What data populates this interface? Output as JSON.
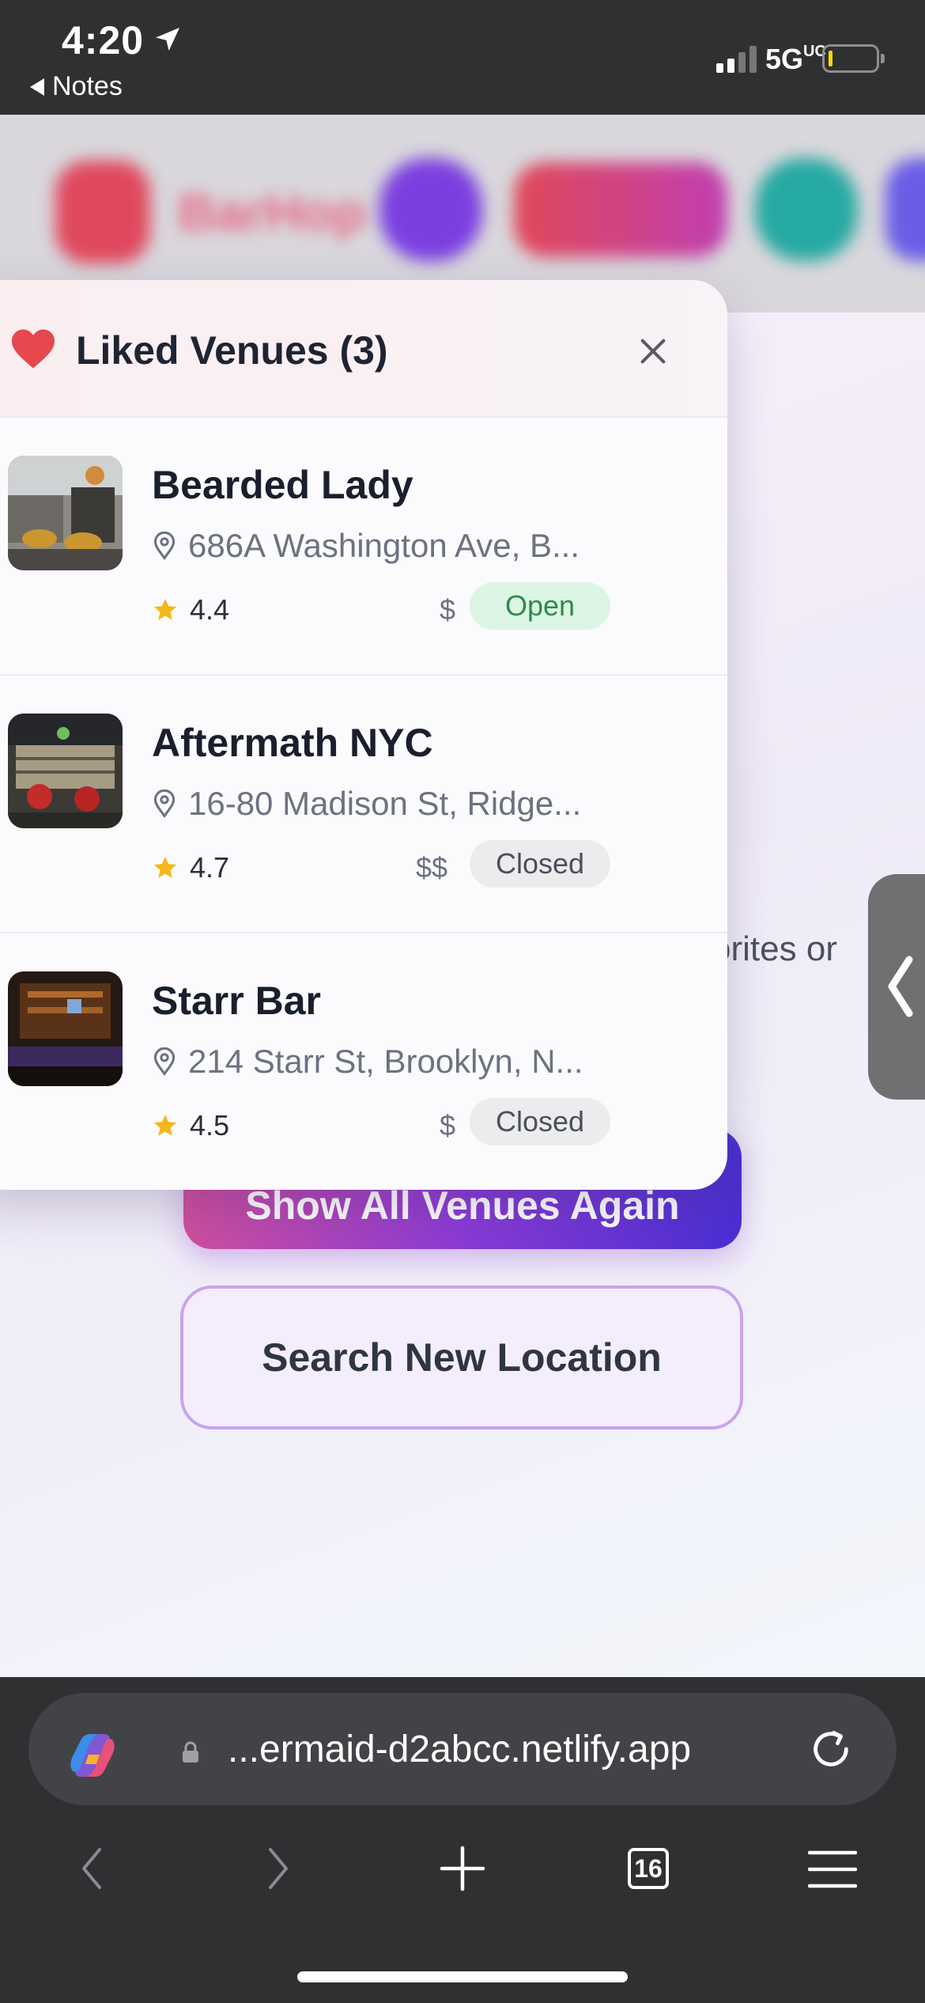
{
  "status_bar": {
    "time": "4:20",
    "back_app": "Notes",
    "network": "5G",
    "network_sup": "UC"
  },
  "page": {
    "partial_text": "orites or",
    "show_all_button": "Show All Venues Again",
    "search_button": "Search New Location"
  },
  "liked_panel": {
    "title": "Liked Venues (3)",
    "venues": [
      {
        "name": "Bearded Lady",
        "address": "686A Washington Ave, B...",
        "rating": "4.4",
        "price": "$",
        "status": "Open"
      },
      {
        "name": "Aftermath NYC",
        "address": "16-80 Madison St, Ridge...",
        "rating": "4.7",
        "price": "$$",
        "status": "Closed"
      },
      {
        "name": "Starr Bar",
        "address": "214 Starr St, Brooklyn, N...",
        "rating": "4.5",
        "price": "$",
        "status": "Closed"
      }
    ]
  },
  "browser": {
    "url": "...ermaid-d2abcc.netlify.app",
    "tabs_count": "16"
  },
  "colors": {
    "accent_start": "#cf4f9e",
    "accent_end": "#4a2fd3",
    "heart": "#e5484d",
    "star": "#f5b81a",
    "open_green": "#2f8a4d"
  },
  "icons": [
    "location-arrow-icon",
    "heart-icon",
    "close-icon",
    "pin-icon",
    "star-icon",
    "lock-icon",
    "reload-icon",
    "back-icon",
    "forward-icon",
    "plus-icon",
    "menu-icon",
    "copilot-icon",
    "chevron-left-icon"
  ]
}
